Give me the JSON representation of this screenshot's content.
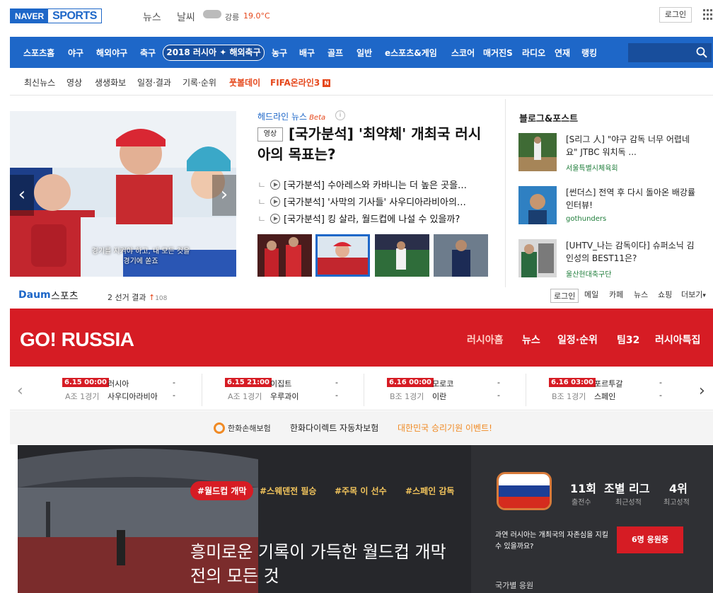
{
  "top": {
    "logo_naver": "NAVER",
    "logo_sports": "SPORTS",
    "news": "뉴스",
    "weather": "날씨",
    "city": "강릉",
    "temp": "19.0°C",
    "login": "로그인"
  },
  "nav": {
    "items": [
      "스포츠홈",
      "야구",
      "해외야구",
      "축구",
      "농구",
      "배구",
      "골프",
      "일반",
      "e스포츠&게임",
      "스코어",
      "매거진S",
      "라디오",
      "연재",
      "랭킹"
    ],
    "special": "2018 러시아 ✦ 해외축구"
  },
  "subnav": {
    "items": [
      "최신뉴스",
      "영상",
      "생생화보",
      "일정·결과",
      "기록·순위"
    ],
    "football_day": "풋볼데이",
    "fifa": "FIFA온라인3",
    "new_badge": "N"
  },
  "headline": {
    "label": "헤드라인 뉴스",
    "beta": "Beta",
    "info": "i",
    "video_badge": "영상",
    "title": "[국가분석] '최약체' 개최국 러시아의 목표는?",
    "list": [
      "[국가분석] 수아레스와 카바니는 더 높은 곳을…",
      "[국가분석] '사막의 기사들' 사우디아라비아의…",
      "[국가분석] 킹 살라, 월드컵에 나설 수 있을까?"
    ],
    "hero_caption": "경기를 지켜야 하고, 내 모든 것을 경기에 쏟죠"
  },
  "blog": {
    "title": "블로그&포스트",
    "posts": [
      {
        "text": "[S리그 人] \"야구 감독 너무 어렵네요\" JTBC 워치독 ...",
        "source": "서울특별시체육회"
      },
      {
        "text": "[썬더스] 전역 후 다시 돌아온 배강률 인터뷰!",
        "source": "gothunders"
      },
      {
        "text": "[UHTV_나는 감독이다] 슈퍼소닉 김인성의 BEST11은?",
        "source": "울산현대축구단"
      }
    ]
  },
  "daum": {
    "logo": "Daum",
    "sports": "스포츠",
    "trend_rank": "2",
    "trend_text": "선거 결과",
    "trend_arrow": "↑",
    "trend_count": "108",
    "links": [
      "로그인",
      "메일",
      "카페",
      "뉴스",
      "쇼핑",
      "더보기"
    ]
  },
  "banner": {
    "logo": "GO! RUSSIA",
    "nav": [
      "러시아홈",
      "뉴스",
      "일정·순위",
      "팀32",
      "러시아특집"
    ]
  },
  "schedule": [
    {
      "time": "6.15 00:00",
      "group": "A조 1경기",
      "team1": "러시아",
      "team2": "사우디아라비아",
      "score1": "-",
      "score2": "-"
    },
    {
      "time": "6.15 21:00",
      "group": "A조 1경기",
      "team1": "이집트",
      "team2": "우루과이",
      "score1": "-",
      "score2": "-"
    },
    {
      "time": "6.16 00:00",
      "group": "B조 1경기",
      "team1": "모로코",
      "team2": "이란",
      "score1": "-",
      "score2": "-"
    },
    {
      "time": "6.16 03:00",
      "group": "B조 1경기",
      "team1": "포르투갈",
      "team2": "스페인",
      "score1": "-",
      "score2": "-"
    }
  ],
  "sponsor": {
    "logo": "한화손해보험",
    "text": "한화다이렉트 자동차보험",
    "event": "대한민국 승리기원 이벤트!"
  },
  "feature": {
    "tags": [
      "#월드컵 개막",
      "#스웨덴전 필승",
      "#주목 이 선수",
      "#스페인 감독"
    ],
    "headline": "흥미로운 기록이 가득한 월드컵 개막전의 모든 것"
  },
  "stats": {
    "values": [
      "11회",
      "조별 리그",
      "4위"
    ],
    "labels": [
      "출전수",
      "최근성적",
      "최고성적"
    ],
    "question": "과연 러시아는 개최국의 자존심을 지킬 수 있을까요?",
    "cheer": "6명 응원중",
    "sub": "국가별 응원"
  },
  "colors": {
    "naver_blue": "#1e67c8",
    "daum_red": "#d61c24"
  }
}
